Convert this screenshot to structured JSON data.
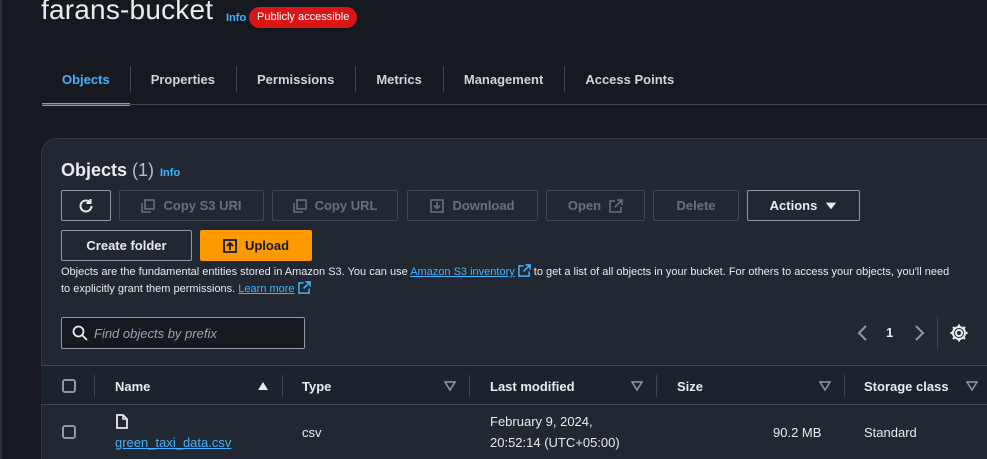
{
  "header": {
    "title": "farans-bucket",
    "info": "Info",
    "badge": "Publicly accessible"
  },
  "tabs": [
    {
      "label": "Objects",
      "active": true
    },
    {
      "label": "Properties"
    },
    {
      "label": "Permissions"
    },
    {
      "label": "Metrics"
    },
    {
      "label": "Management"
    },
    {
      "label": "Access Points"
    }
  ],
  "objects_section": {
    "title": "Objects",
    "count": "(1)",
    "info": "Info",
    "buttons": {
      "refresh": "",
      "copy_s3_uri": "Copy S3 URI",
      "copy_url": "Copy URL",
      "download": "Download",
      "open": "Open",
      "delete": "Delete",
      "actions": "Actions",
      "create_folder": "Create folder",
      "upload": "Upload"
    },
    "description": {
      "part1": "Objects are the fundamental entities stored in Amazon S3. You can use ",
      "link1": "Amazon S3 inventory",
      "part2": " to get a list of all objects in your bucket. For others to access your objects, you'll need to explicitly grant them permissions. ",
      "link2": "Learn more"
    },
    "search": {
      "placeholder": "Find objects by prefix",
      "value": ""
    },
    "pagination": {
      "page": "1"
    }
  },
  "table": {
    "columns": {
      "name": "Name",
      "type": "Type",
      "last_modified": "Last modified",
      "size": "Size",
      "storage_class": "Storage class"
    },
    "rows": [
      {
        "name": "green_taxi_data.csv",
        "type": "csv",
        "last_modified_line1": "February 9, 2024,",
        "last_modified_line2": "20:52:14 (UTC+05:00)",
        "size": "90.2 MB",
        "storage_class": "Standard"
      }
    ]
  },
  "colors": {
    "accent": "#42b4ff",
    "primary": "#ff9900",
    "badge": "#d91515",
    "background": "#16191f"
  }
}
